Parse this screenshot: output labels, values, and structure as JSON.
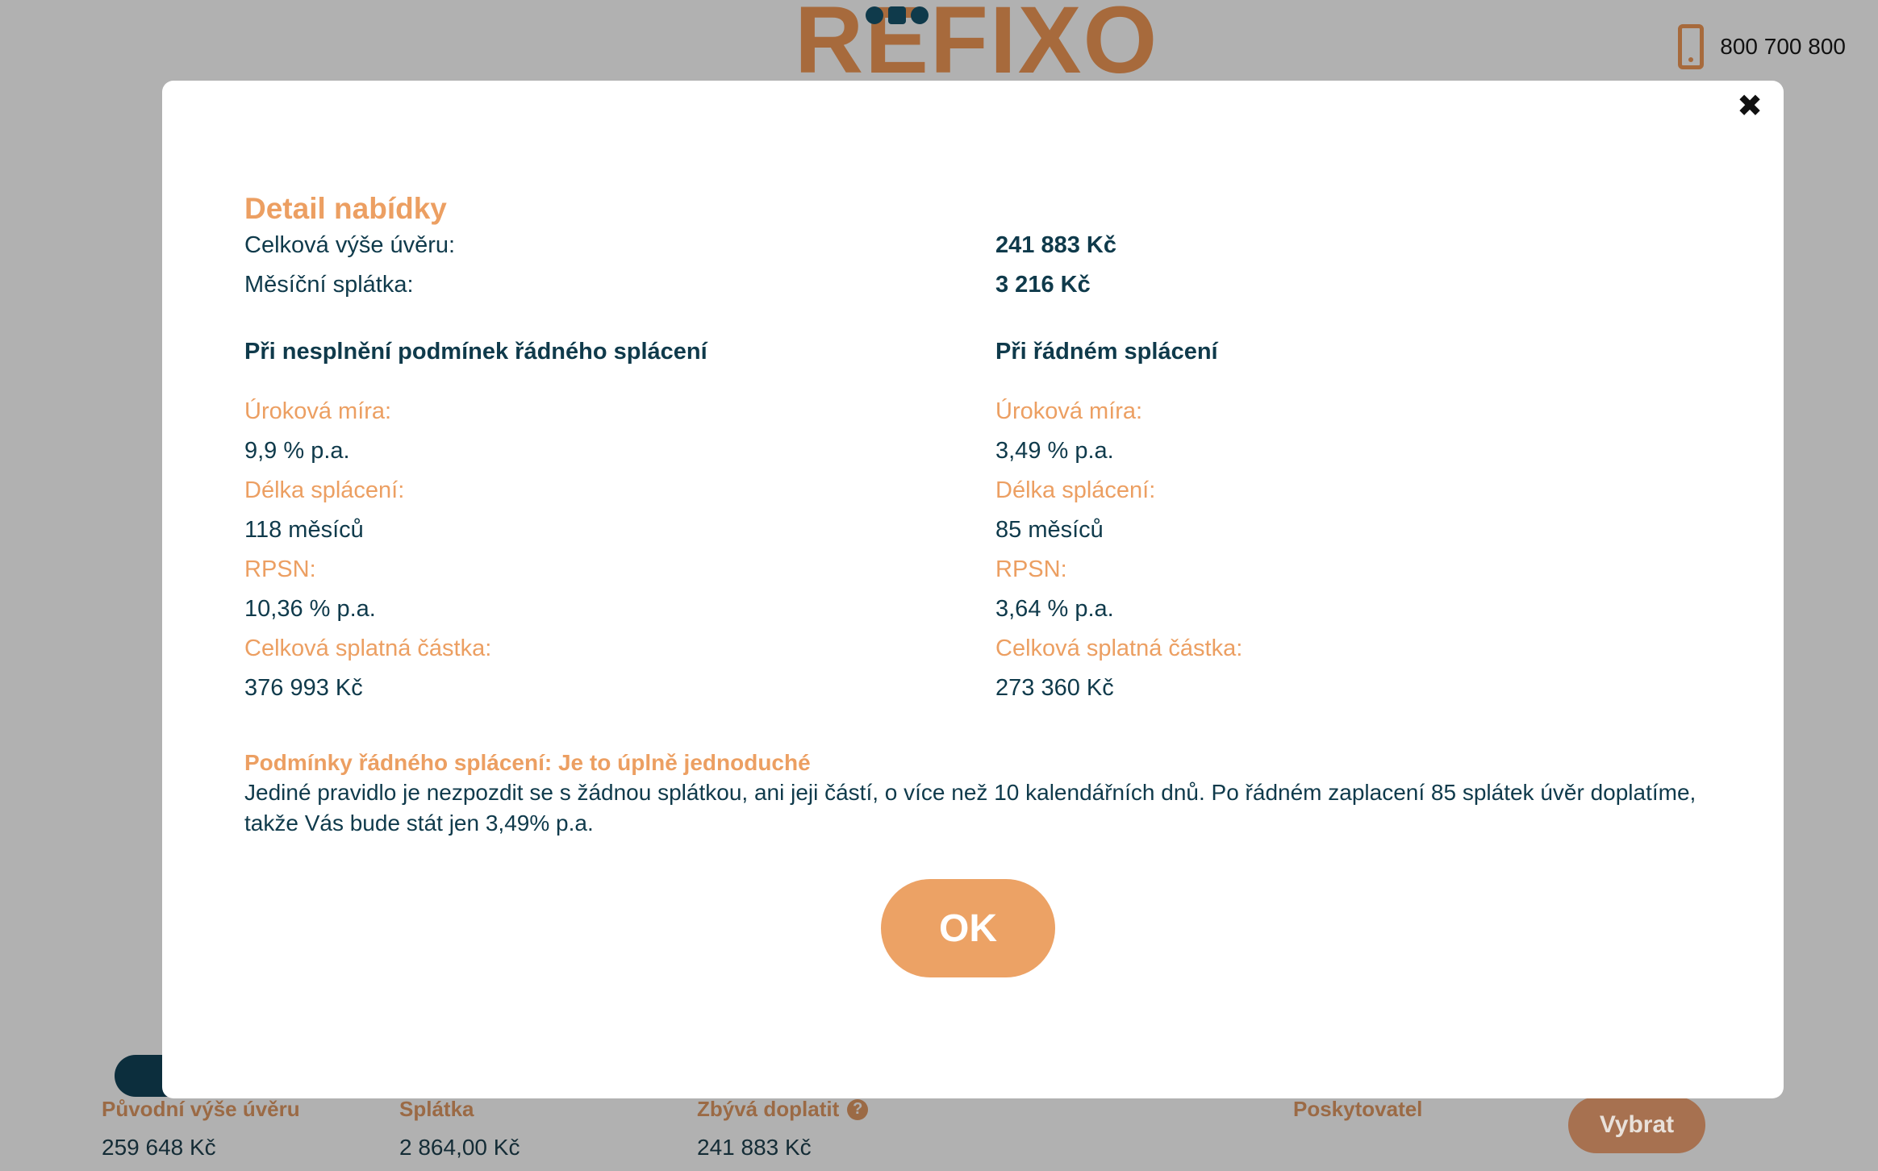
{
  "header": {
    "logo_text": "REFIXO",
    "phone": "800 700 800"
  },
  "summary": {
    "original_amount_label": "Původní výše úvěru",
    "original_amount_value": "259 648 Kč",
    "installment_label": "Splátka",
    "installment_value": "2 864,00 Kč",
    "remaining_label": "Zbývá doplatit",
    "remaining_value": "241 883 Kč",
    "provider_label": "Poskytovatel",
    "select_button": "Vybrat"
  },
  "modal": {
    "title": "Detail nabídky",
    "total_loan_label": "Celková výše úvěru:",
    "total_loan_value": "241 883 Kč",
    "monthly_label": "Měsíční splátka:",
    "monthly_value": "3 216 Kč",
    "left": {
      "heading": "Při nesplnění podmínek řádného splácení",
      "rate_label": "Úroková míra:",
      "rate_value": "9,9 % p.a.",
      "term_label": "Délka splácení:",
      "term_value": "118 měsíců",
      "rpsn_label": "RPSN:",
      "rpsn_value": "10,36 % p.a.",
      "total_label": "Celková splatná částka:",
      "total_value": "376 993 Kč"
    },
    "right": {
      "heading": "Při řádném splácení",
      "rate_label": "Úroková míra:",
      "rate_value": "3,49 % p.a.",
      "term_label": "Délka splácení:",
      "term_value": "85 měsíců",
      "rpsn_label": "RPSN:",
      "rpsn_value": "3,64 % p.a.",
      "total_label": "Celková splatná částka:",
      "total_value": "273 360 Kč"
    },
    "conditions_title": "Podmínky řádného splácení: Je to úplně jednoduché",
    "conditions_text": "Jediné pravidlo je nezpozdit se s žádnou splátkou, ani jeji částí, o více než 10 kalendářních dnů. Po řádném zaplacení 85 splátek úvěr doplatíme, takže Vás bude stát jen 3,49% p.a.",
    "ok_button": "OK",
    "close_symbol": "✖"
  },
  "colors": {
    "overlay": "#b1b1b1",
    "accent": "#ec9f62",
    "text": "#0f3a4b"
  }
}
